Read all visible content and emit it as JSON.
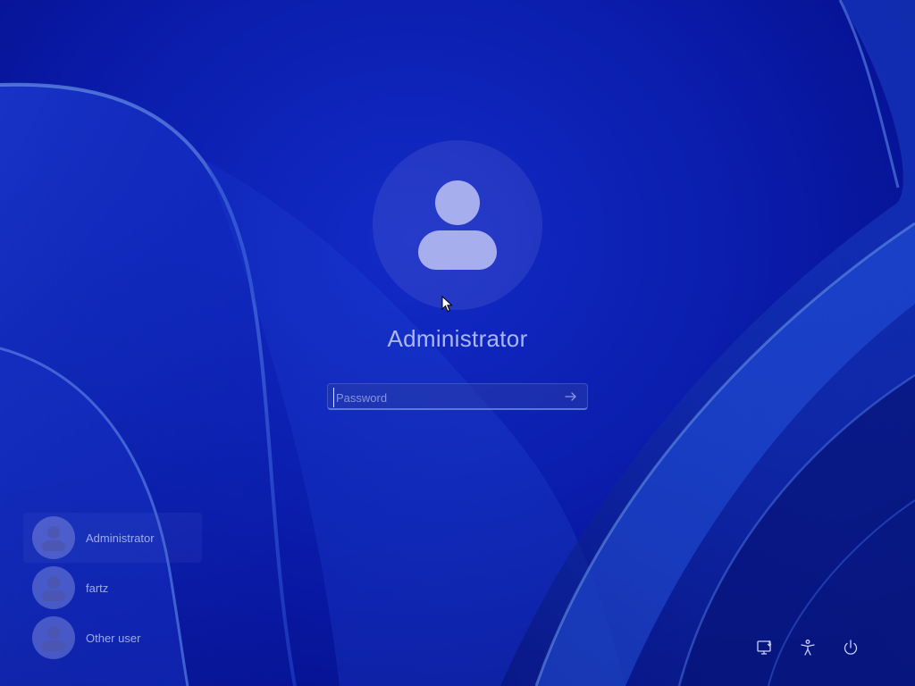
{
  "login": {
    "username": "Administrator",
    "password_placeholder": "Password",
    "password_value": ""
  },
  "users": [
    {
      "name": "Administrator",
      "selected": true
    },
    {
      "name": "fartz",
      "selected": false
    },
    {
      "name": "Other user",
      "selected": false
    }
  ],
  "icons": {
    "avatar": "user-avatar-icon",
    "submit": "arrow-right-icon",
    "network": "network-icon",
    "accessibility": "accessibility-icon",
    "power": "power-icon"
  },
  "colors": {
    "background": "#0b1fb8",
    "text": "#b4bef5"
  }
}
